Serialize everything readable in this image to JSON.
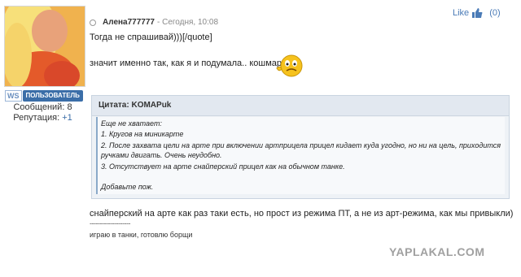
{
  "user": {
    "ws_badge": "WS",
    "role": "ПОЛЬЗОВАТЕЛЬ",
    "messages_label": "Сообщений: 8",
    "reputation_label": "Репутация:",
    "reputation_value": "+1"
  },
  "post": {
    "author": "Алена777777",
    "time": "- Сегодня, 10:08",
    "like_label": "Like",
    "like_count": "0",
    "line1": "Тогда не спрашивай)))[/quote]",
    "line2": "значит именно так, как я и подумала.. кошмар )",
    "quote": {
      "title": "Цитата: KOMAPuk",
      "lines": [
        "Еще не хватает:",
        "1. Кругов на миникарте",
        "2. После захвата цели на арте при включении артприцела прицел кидает куда угодно, но ни на цель, приходится",
        "ручками двигать. Очень неудобно.",
        "3. Отсутствует на арте снайперский прицел как на обычном танке.",
        "Добавьте пож."
      ]
    },
    "line3": "снайперский на арте как раз таки есть, но прост из режима ПТ, а не из арт-режима, как мы привыкли)",
    "divider": "--------------------",
    "signature": "играю в танки, готовлю борщи"
  },
  "watermark": "YAPLAKAL.COM",
  "icons": [
    "avatar",
    "thumbs-up-icon",
    "smiley-icon"
  ]
}
